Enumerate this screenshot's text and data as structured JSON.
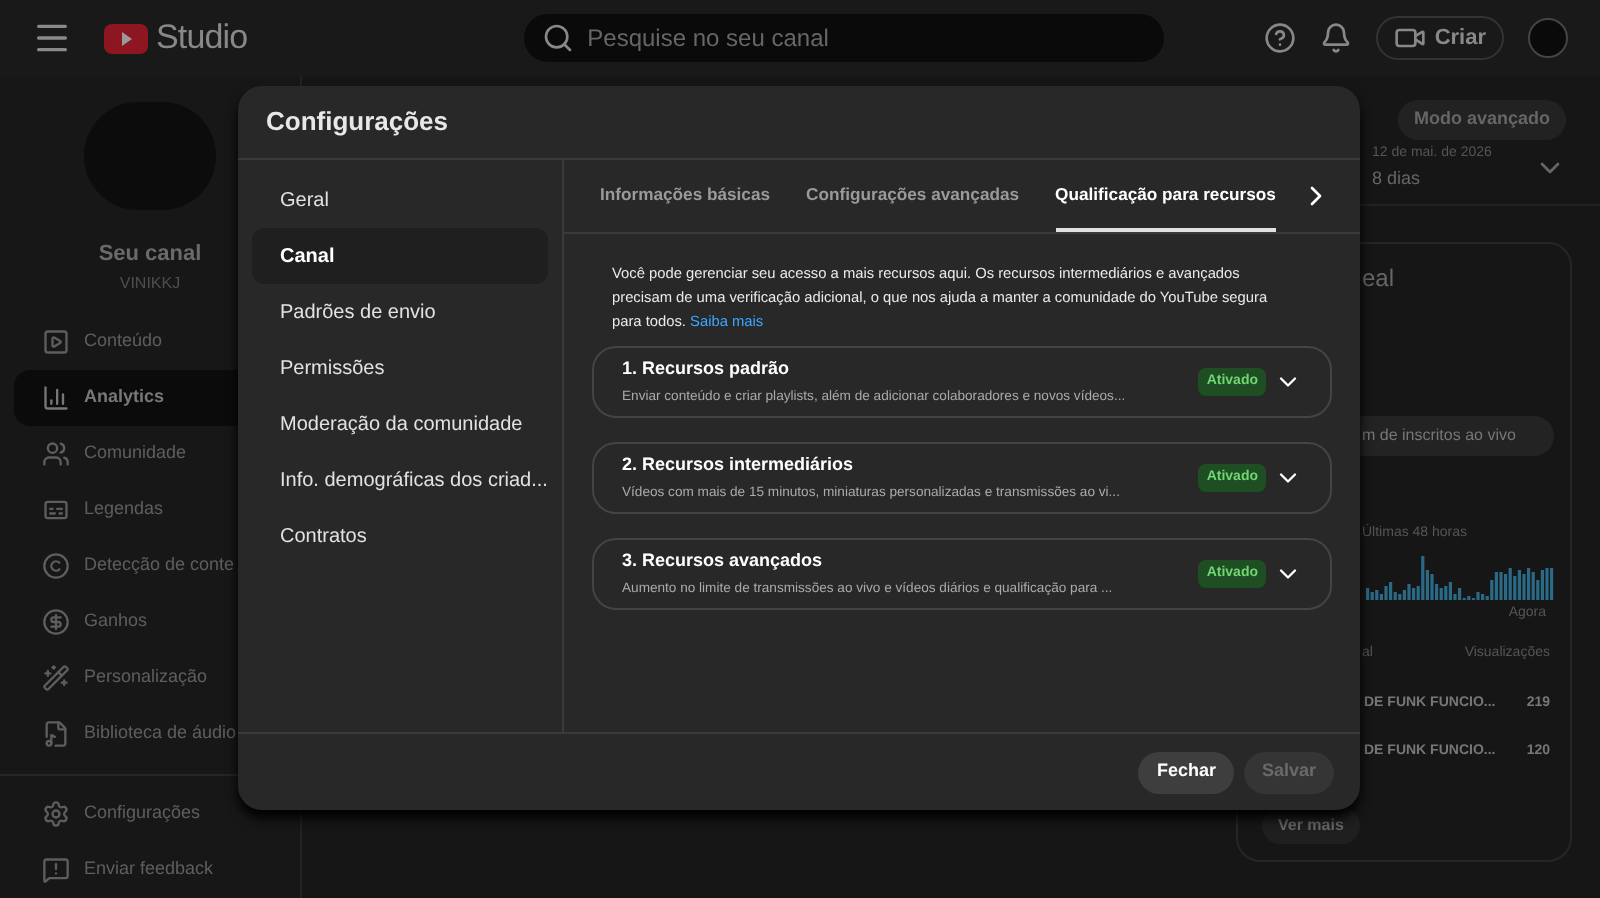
{
  "header": {
    "logo_text": "Studio",
    "search": {
      "placeholder": "Pesquise no seu canal"
    },
    "create_button": "Criar"
  },
  "sidebar": {
    "channel_title": "Seu canal",
    "channel_name": "VINIKKJ",
    "items": [
      {
        "label": "Conteúdo",
        "selected": false
      },
      {
        "label": "Analytics",
        "selected": true
      },
      {
        "label": "Comunidade",
        "selected": false
      },
      {
        "label": "Legendas",
        "selected": false
      },
      {
        "label": "Detecção de conte",
        "selected": false
      },
      {
        "label": "Ganhos",
        "selected": false
      },
      {
        "label": "Personalização",
        "selected": false
      },
      {
        "label": "Biblioteca de áudio",
        "selected": false
      }
    ],
    "footer_items": [
      {
        "label": "Configurações"
      },
      {
        "label": "Enviar feedback"
      }
    ]
  },
  "background": {
    "advanced_button": "Modo avançado",
    "date_range": "12 de mai. de 2026",
    "period": "8 dias",
    "card_title": "eal",
    "subs_button": "m de inscritos ao vivo",
    "chart_caption": "Últimas 48 horas",
    "chart_end": "Agora",
    "column_1": "al",
    "column_2": "Visualizações",
    "rows": [
      {
        "title": "DE FUNK FUNCIO...",
        "views": "219"
      },
      {
        "title": "DE FUNK FUNCIO...",
        "views": "120"
      }
    ],
    "more_button": "Ver mais"
  },
  "dialog": {
    "title": "Configurações",
    "menu": [
      {
        "label": "Geral",
        "selected": false
      },
      {
        "label": "Canal",
        "selected": true
      },
      {
        "label": "Padrões de envio",
        "selected": false
      },
      {
        "label": "Permissões",
        "selected": false
      },
      {
        "label": "Moderação da comunidade",
        "selected": false
      },
      {
        "label": "Info. demográficas dos criad...",
        "selected": false
      },
      {
        "label": "Contratos",
        "selected": false
      }
    ],
    "tabs": [
      {
        "label": "Informações básicas",
        "selected": false
      },
      {
        "label": "Configurações avançadas",
        "selected": false
      },
      {
        "label": "Qualificação para recursos",
        "selected": true
      }
    ],
    "intro": "Você pode gerenciar seu acesso a mais recursos aqui. Os recursos intermediários e avançados precisam de uma verificação adicional, o que nos ajuda a manter a comunidade do YouTube segura para todos.",
    "intro_link": "Saiba mais",
    "features": [
      {
        "title": "1. Recursos padrão",
        "description": "Enviar conteúdo e criar playlists, além de adicionar colaboradores e novos vídeos...",
        "status": "Ativado",
        "expanded": false
      },
      {
        "title": "2. Recursos intermediários",
        "description": "Vídeos com mais de 15 minutos, miniaturas personalizadas e transmissões ao vi...",
        "status": "Ativado",
        "expanded": false
      },
      {
        "title": "3. Recursos avançados",
        "description": "Aumento no limite de transmissões ao vivo e vídeos diários e qualificação para ...",
        "status": "Ativado",
        "expanded": false
      }
    ],
    "buttons": [
      {
        "label": "Fechar",
        "disabled": false
      },
      {
        "label": "Salvar",
        "disabled": true
      }
    ]
  }
}
